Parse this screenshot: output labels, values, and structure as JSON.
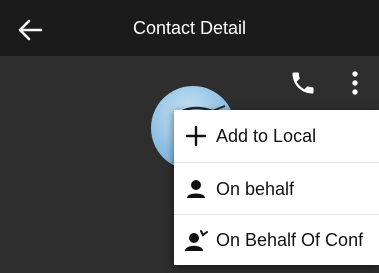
{
  "app_bar": {
    "title": "Contact Detail",
    "back_icon": "arrow-left-icon"
  },
  "actions": {
    "call_icon": "phone-icon",
    "more_icon": "more-vertical-icon"
  },
  "avatar": {
    "icon": "contact-photo"
  },
  "menu": {
    "items": [
      {
        "label": "Add to Local",
        "icon": "plus-icon"
      },
      {
        "label": "On behalf",
        "icon": "person-icon"
      },
      {
        "label": "On Behalf Of Conf",
        "icon": "person-conference-icon"
      }
    ]
  },
  "colors": {
    "app_bar_bg": "#1b1b1b",
    "page_bg": "#2e2e2e",
    "menu_bg": "#ffffff",
    "icon_dark": "#111111"
  }
}
